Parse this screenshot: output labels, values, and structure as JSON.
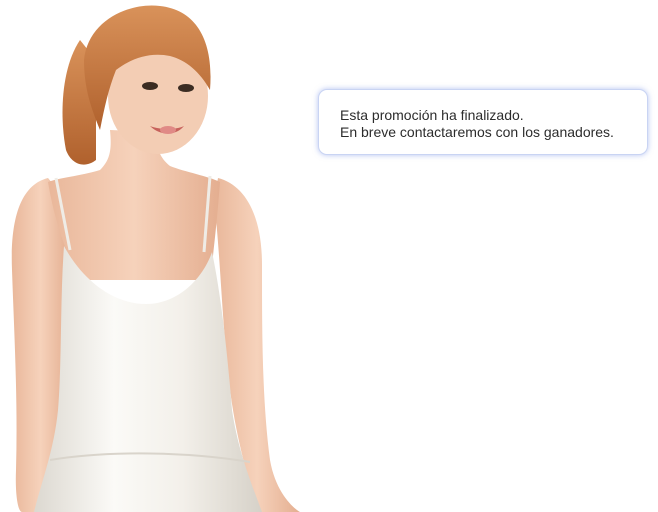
{
  "promo": {
    "message_line_1": "Esta promoción ha finalizado.",
    "message_line_2": "En breve contactaremos con los ganadores."
  },
  "colors": {
    "background": "#ffffff",
    "box_border": "#c9d4f3",
    "box_glow": "#7891e6",
    "text": "#2c2c2c",
    "hair": "#c8783f",
    "skin": "#f1c7aa",
    "dress": "#f2efe9"
  }
}
